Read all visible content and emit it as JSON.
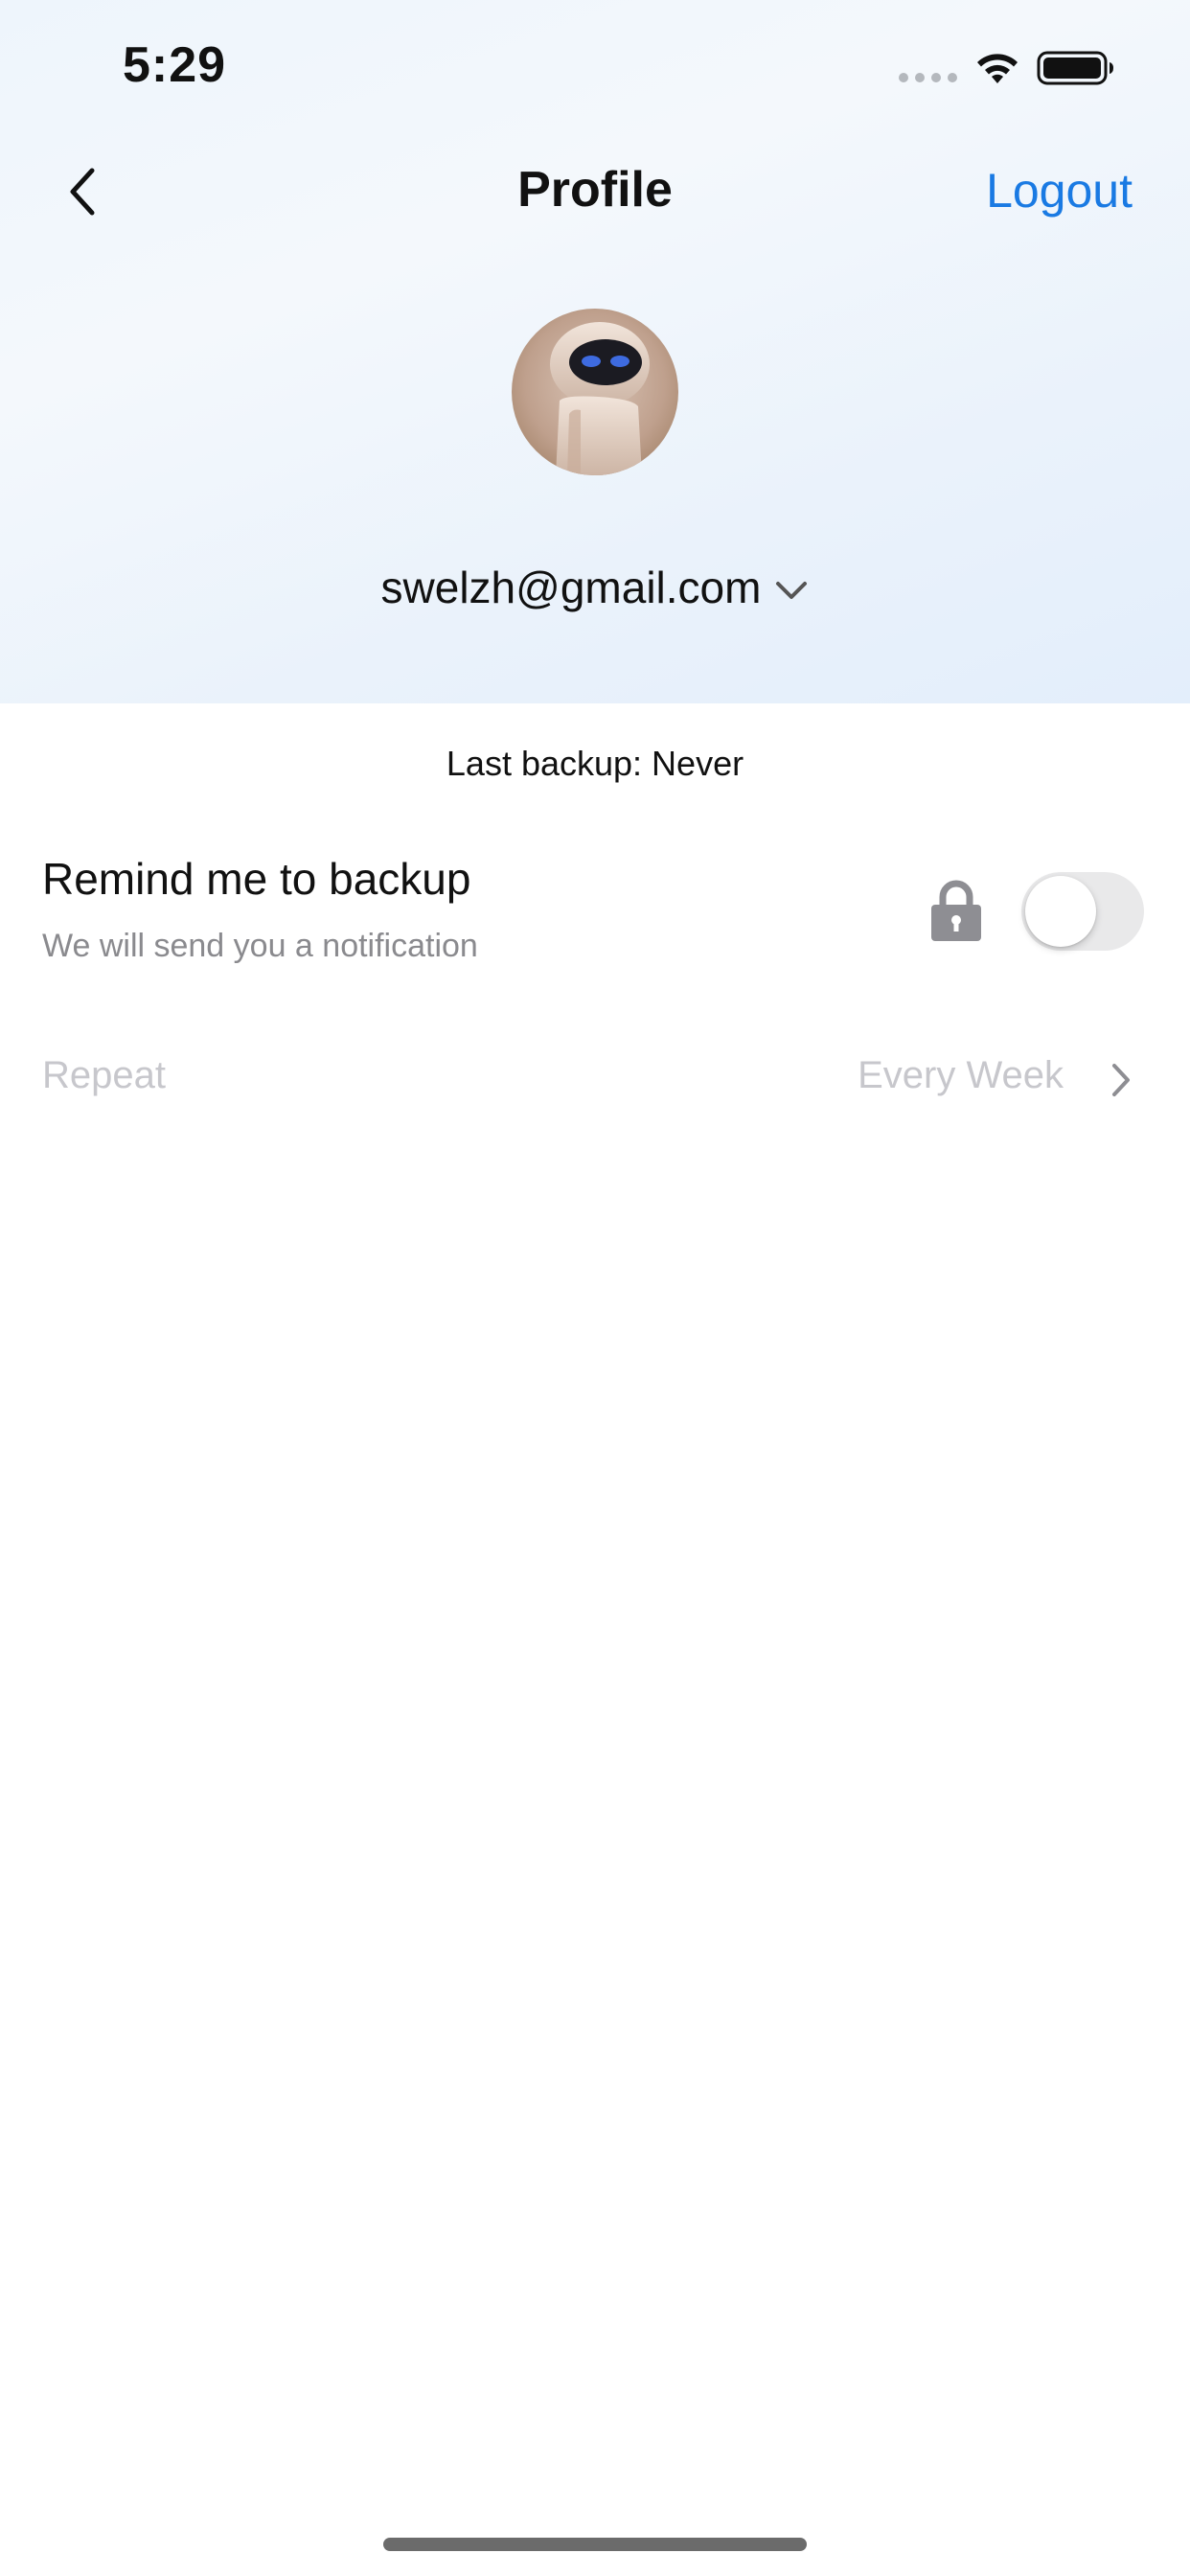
{
  "status_bar": {
    "time": "5:29"
  },
  "nav": {
    "title": "Profile",
    "logout_label": "Logout",
    "back_icon": "chevron-left-icon"
  },
  "account": {
    "email": "swelzh@gmail.com",
    "avatar": "robot-avatar"
  },
  "backup": {
    "last_backup_text": "Last backup: Never",
    "remind_title": "Remind me to backup",
    "remind_subtitle": "We will send you a notification",
    "remind_enabled": false,
    "locked": true,
    "repeat_label": "Repeat",
    "repeat_value": "Every Week"
  },
  "colors": {
    "accent": "#1a7ae3",
    "disabled_text": "#c7c7cc",
    "secondary_text": "#8a8a8e",
    "toggle_off": "#e9e9ea"
  }
}
